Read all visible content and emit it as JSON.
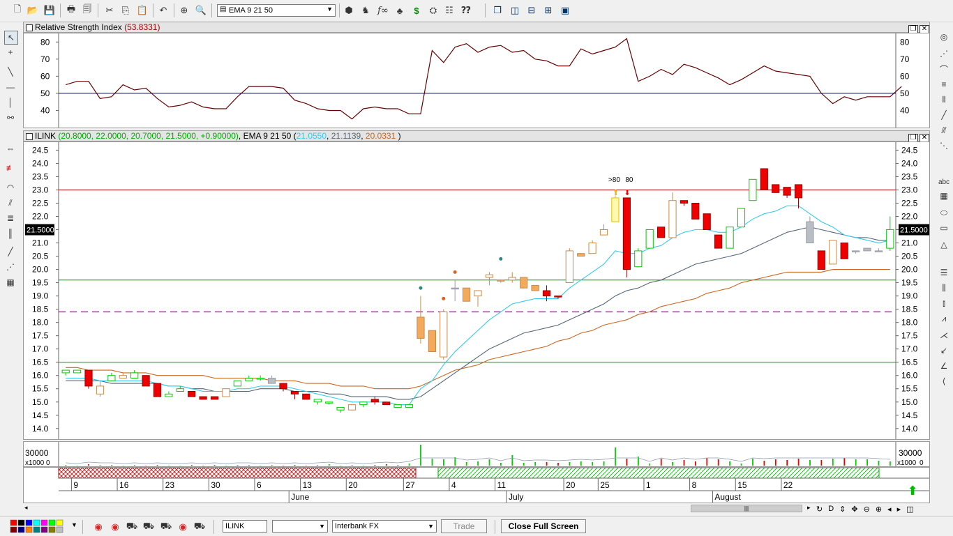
{
  "toolbar": {
    "indicator_select": "EMA 9 21 50",
    "icons": [
      "new-file-icon",
      "open-folder-icon",
      "save-icon",
      "print-icon",
      "print-preview-icon",
      "cut-icon",
      "copy-icon",
      "paste-icon",
      "undo-icon",
      "crosshair-icon",
      "zoom-icon",
      "indicator-select",
      "cube-icon",
      "trader-icon",
      "function-icon",
      "tree-icon",
      "dollar-icon",
      "binoculars-icon",
      "properties-icon",
      "help-icon",
      "windows-icon",
      "split-vertical-icon",
      "split-horizontal-icon",
      "grid-icon",
      "snapshot-icon"
    ]
  },
  "rsi_panel": {
    "title": "Relative Strength Index",
    "value": "(53.8331)",
    "ticks": [
      "80",
      "70",
      "60",
      "50",
      "40"
    ]
  },
  "price_panel": {
    "symbol": "ILINK",
    "ohlc": "(20.8000, 22.0000, 20.7000, 21.5000, +0.90000)",
    "indicator": "EMA 9 21 50",
    "ema_open": "(",
    "ema_fast": "21.0550",
    "ema_mid": "21.1139",
    "ema_slow": "20.0331",
    "ema_close": ")",
    "last_price": "21.5000",
    "ticks": [
      "24.5",
      "24.0",
      "23.5",
      "23.0",
      "22.5",
      "22.0",
      "21.5",
      "21.0",
      "20.5",
      "20.0",
      "19.5",
      "19.0",
      "18.5",
      "18.0",
      "17.5",
      "17.0",
      "16.5",
      "16.0",
      "15.5",
      "15.0",
      "14.5",
      "14.0"
    ],
    "annotations": [
      ">80",
      "80"
    ]
  },
  "volume_panel": {
    "tick": "30000",
    "multiplier": "x1000",
    "zero": "0"
  },
  "time_axis": {
    "days": [
      "9",
      "16",
      "23",
      "30",
      "6",
      "13",
      "20",
      "27",
      "4",
      "11",
      "20",
      "25",
      "1",
      "8",
      "15",
      "22"
    ],
    "months": [
      "June",
      "July",
      "August"
    ]
  },
  "bottom": {
    "symbol_input": "ILINK",
    "blank_select": "",
    "feed_select": "Interbank FX",
    "trade_label": "Trade",
    "fullscreen_label": "Close Full Screen"
  },
  "colors": {
    "up": "#00cc00",
    "down": "#ee0000",
    "ema_fast": "#33ccee",
    "ema_mid": "#556677",
    "ema_slow": "#cc6622",
    "rsi_line": "#660000",
    "level_red": "#aa0000",
    "level_green": "#009900",
    "level_magenta": "#cc00cc"
  },
  "candles": [
    [
      16.2,
      16.2,
      16.0,
      16.1,
      "g"
    ],
    [
      16.2,
      16.2,
      16.1,
      16.1,
      "g"
    ],
    [
      16.2,
      16.2,
      15.5,
      15.6,
      "r"
    ],
    [
      15.6,
      15.8,
      15.2,
      15.3,
      "w"
    ],
    [
      15.8,
      16.1,
      15.8,
      16.0,
      "g"
    ],
    [
      16.0,
      16.1,
      15.9,
      15.9,
      "w"
    ],
    [
      15.9,
      16.2,
      15.9,
      16.1,
      "g"
    ],
    [
      16.0,
      16.0,
      15.6,
      15.6,
      "r"
    ],
    [
      15.7,
      15.7,
      15.2,
      15.2,
      "r"
    ],
    [
      15.2,
      15.4,
      15.2,
      15.3,
      "g"
    ],
    [
      15.4,
      15.6,
      15.4,
      15.5,
      "g"
    ],
    [
      15.4,
      15.4,
      15.2,
      15.2,
      "r"
    ],
    [
      15.2,
      15.2,
      15.1,
      15.1,
      "r"
    ],
    [
      15.2,
      15.2,
      15.1,
      15.1,
      "r"
    ],
    [
      15.2,
      15.5,
      15.2,
      15.5,
      "w"
    ],
    [
      15.6,
      15.8,
      15.6,
      15.8,
      "g"
    ],
    [
      15.8,
      16.0,
      15.8,
      15.9,
      "g"
    ],
    [
      15.9,
      16.0,
      15.8,
      15.9,
      "g"
    ],
    [
      15.9,
      16.0,
      15.8,
      15.7,
      "s"
    ],
    [
      15.7,
      15.7,
      15.4,
      15.5,
      "r"
    ],
    [
      15.4,
      15.4,
      15.1,
      15.3,
      "r"
    ],
    [
      15.3,
      15.3,
      15.1,
      15.1,
      "r"
    ],
    [
      15.1,
      15.1,
      14.9,
      15.0,
      "g"
    ],
    [
      15.0,
      15.0,
      14.9,
      15.0,
      "g"
    ],
    [
      14.8,
      14.8,
      14.6,
      14.7,
      "g"
    ],
    [
      14.9,
      14.9,
      14.7,
      14.7,
      "w"
    ],
    [
      14.9,
      15.0,
      14.8,
      15.0,
      "g"
    ],
    [
      15.0,
      15.2,
      14.9,
      15.1,
      "r"
    ],
    [
      15.0,
      15.0,
      14.9,
      14.9,
      "r"
    ],
    [
      14.9,
      14.9,
      14.8,
      14.8,
      "g"
    ],
    [
      14.9,
      14.9,
      14.8,
      14.8,
      "g"
    ],
    [
      18.2,
      19.0,
      17.2,
      17.4,
      "o"
    ],
    [
      17.7,
      17.7,
      16.9,
      16.9,
      "o"
    ],
    [
      16.7,
      18.5,
      16.6,
      18.4,
      "w"
    ],
    [
      19.3,
      19.6,
      18.8,
      19.3,
      "s"
    ],
    [
      19.3,
      19.3,
      18.8,
      18.8,
      "o"
    ],
    [
      19.2,
      19.2,
      18.6,
      19.0,
      "w"
    ],
    [
      19.8,
      19.9,
      19.4,
      19.7,
      "w"
    ],
    [
      19.6,
      19.6,
      19.5,
      19.6,
      "o"
    ],
    [
      19.6,
      19.9,
      19.5,
      19.7,
      "w"
    ],
    [
      19.7,
      19.7,
      19.3,
      19.3,
      "o"
    ],
    [
      19.4,
      19.4,
      19.2,
      19.2,
      "o"
    ],
    [
      19.2,
      19.4,
      18.8,
      19.0,
      "r"
    ],
    [
      19.0,
      19.0,
      18.9,
      19.0,
      "r"
    ],
    [
      19.5,
      20.8,
      19.5,
      20.7,
      "w"
    ],
    [
      20.6,
      20.6,
      20.5,
      20.5,
      "o"
    ],
    [
      20.6,
      21.1,
      20.6,
      21.0,
      "w"
    ],
    [
      21.3,
      21.7,
      21.3,
      21.5,
      "w"
    ],
    [
      21.8,
      22.8,
      21.8,
      22.7,
      "y"
    ],
    [
      22.7,
      22.7,
      19.7,
      20.0,
      "r"
    ],
    [
      20.1,
      20.8,
      20.1,
      20.7,
      "g"
    ],
    [
      20.8,
      21.5,
      20.8,
      21.5,
      "g"
    ],
    [
      21.6,
      21.6,
      21.2,
      21.2,
      "r"
    ],
    [
      21.2,
      22.9,
      21.2,
      22.6,
      "w"
    ],
    [
      22.6,
      22.6,
      22.4,
      22.5,
      "r"
    ],
    [
      22.5,
      22.5,
      21.9,
      21.9,
      "r"
    ],
    [
      22.1,
      22.1,
      21.5,
      21.5,
      "r"
    ],
    [
      21.3,
      21.3,
      20.8,
      20.8,
      "r"
    ],
    [
      20.8,
      21.6,
      20.8,
      21.6,
      "g"
    ],
    [
      21.6,
      22.3,
      21.6,
      22.3,
      "g"
    ],
    [
      22.6,
      23.4,
      22.6,
      23.4,
      "g"
    ],
    [
      23.8,
      23.8,
      23.0,
      23.0,
      "r"
    ],
    [
      23.2,
      23.2,
      22.9,
      22.9,
      "r"
    ],
    [
      23.1,
      23.1,
      22.7,
      22.8,
      "r"
    ],
    [
      23.2,
      23.2,
      22.3,
      22.7,
      "r"
    ],
    [
      21.8,
      22.0,
      21.0,
      21.0,
      "s"
    ],
    [
      20.7,
      20.7,
      20.0,
      20.0,
      "r"
    ],
    [
      20.2,
      21.1,
      20.2,
      21.1,
      "w"
    ],
    [
      21.0,
      21.0,
      20.5,
      20.4,
      "r"
    ],
    [
      20.7,
      20.7,
      20.6,
      20.7,
      "s"
    ],
    [
      20.8,
      20.8,
      20.7,
      20.7,
      "s"
    ],
    [
      20.7,
      20.8,
      20.7,
      20.7,
      "s"
    ],
    [
      20.8,
      22.0,
      20.7,
      21.5,
      "g"
    ]
  ],
  "ema_fast": [
    15.9,
    15.9,
    15.9,
    15.8,
    15.8,
    15.8,
    15.8,
    15.8,
    15.7,
    15.6,
    15.6,
    15.5,
    15.4,
    15.4,
    15.4,
    15.5,
    15.5,
    15.6,
    15.6,
    15.6,
    15.5,
    15.4,
    15.3,
    15.2,
    15.1,
    15.0,
    15.0,
    15.0,
    15.0,
    14.9,
    14.9,
    15.5,
    15.8,
    16.4,
    16.9,
    17.3,
    17.7,
    18.1,
    18.4,
    18.7,
    18.8,
    18.9,
    18.9,
    18.9,
    19.3,
    19.6,
    19.9,
    20.2,
    20.7,
    20.6,
    20.6,
    20.8,
    20.9,
    21.2,
    21.4,
    21.5,
    21.5,
    21.4,
    21.4,
    21.6,
    21.9,
    22.1,
    22.2,
    22.4,
    22.4,
    22.1,
    21.8,
    21.6,
    21.3,
    21.2,
    21.1,
    21.0,
    21.1
  ],
  "ema_mid": [
    15.8,
    15.8,
    15.8,
    15.8,
    15.7,
    15.7,
    15.7,
    15.7,
    15.7,
    15.6,
    15.6,
    15.5,
    15.5,
    15.4,
    15.4,
    15.4,
    15.4,
    15.5,
    15.5,
    15.5,
    15.4,
    15.4,
    15.4,
    15.3,
    15.3,
    15.2,
    15.2,
    15.2,
    15.2,
    15.1,
    15.1,
    15.2,
    15.5,
    15.8,
    16.1,
    16.4,
    16.7,
    17.0,
    17.2,
    17.4,
    17.6,
    17.7,
    17.8,
    17.9,
    18.1,
    18.3,
    18.5,
    18.7,
    19.0,
    19.2,
    19.3,
    19.5,
    19.6,
    19.8,
    20.0,
    20.2,
    20.3,
    20.4,
    20.5,
    20.6,
    20.8,
    21.0,
    21.2,
    21.4,
    21.5,
    21.6,
    21.5,
    21.4,
    21.3,
    21.2,
    21.2,
    21.1,
    21.1
  ],
  "ema_slow": [
    16.3,
    16.3,
    16.2,
    16.2,
    16.2,
    16.1,
    16.1,
    16.1,
    16.0,
    16.0,
    16.0,
    16.0,
    16.0,
    15.9,
    15.9,
    15.9,
    15.9,
    15.9,
    15.8,
    15.8,
    15.8,
    15.7,
    15.7,
    15.7,
    15.6,
    15.6,
    15.6,
    15.5,
    15.5,
    15.5,
    15.5,
    15.6,
    15.8,
    16.0,
    16.2,
    16.3,
    16.4,
    16.6,
    16.7,
    16.8,
    16.9,
    17.0,
    17.1,
    17.3,
    17.4,
    17.6,
    17.7,
    17.9,
    18.0,
    18.1,
    18.3,
    18.4,
    18.6,
    18.7,
    18.8,
    18.9,
    19.1,
    19.2,
    19.3,
    19.5,
    19.6,
    19.7,
    19.8,
    19.9,
    19.9,
    19.9,
    19.9,
    20.0,
    20.0,
    20.0,
    20.0,
    20.0,
    20.0
  ],
  "rsi": [
    55,
    57,
    57,
    47,
    48,
    55,
    52,
    53,
    47,
    42,
    43,
    45,
    42,
    41,
    41,
    48,
    54,
    54,
    54,
    53,
    46,
    44,
    41,
    40,
    40,
    35,
    41,
    42,
    41,
    41,
    38,
    38,
    75,
    68,
    77,
    79,
    74,
    77,
    78,
    74,
    75,
    70,
    69,
    66,
    66,
    76,
    73,
    75,
    77,
    82,
    57,
    60,
    64,
    61,
    67,
    65,
    62,
    59,
    55,
    58,
    62,
    66,
    63,
    62,
    61,
    60,
    50,
    44,
    48,
    46,
    48,
    48,
    48,
    54
  ],
  "volumes": [
    1,
    0,
    2,
    1,
    1,
    0,
    1,
    0,
    1,
    0,
    0,
    1,
    0,
    1,
    0,
    1,
    1,
    0,
    1,
    0,
    1,
    0,
    1,
    2,
    0,
    1,
    0,
    1,
    2,
    1,
    3,
    30,
    10,
    9,
    12,
    5,
    6,
    9,
    4,
    15,
    4,
    5,
    5,
    4,
    5,
    6,
    5,
    6,
    26,
    10,
    13,
    3,
    10,
    5,
    8,
    6,
    11,
    9,
    6,
    3,
    10,
    7,
    9,
    8,
    10,
    8,
    8,
    10,
    11,
    9,
    9,
    7,
    6,
    10,
    8,
    10
  ]
}
